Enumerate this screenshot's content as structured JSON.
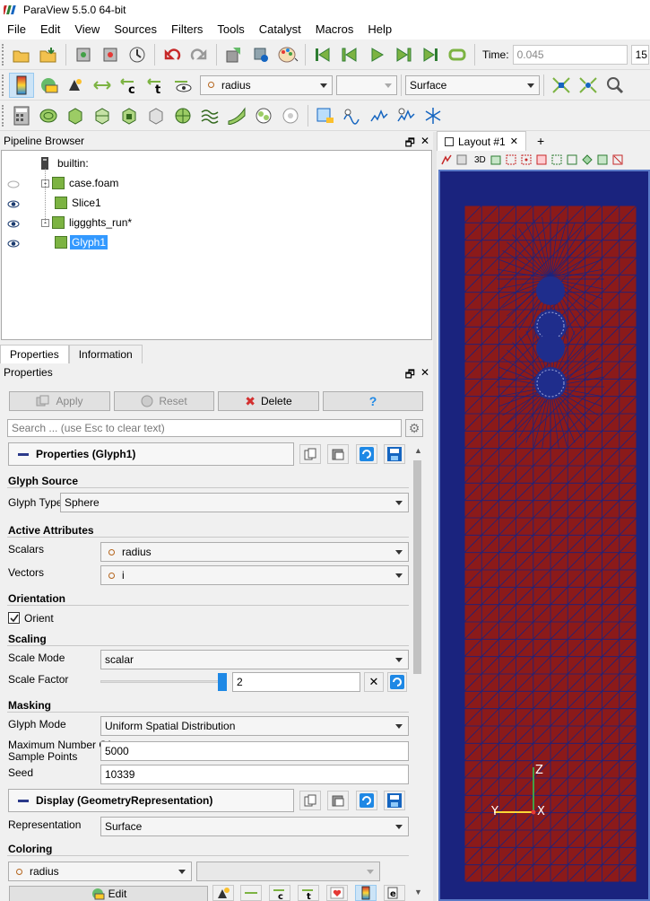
{
  "window": {
    "title": "ParaView 5.5.0 64-bit"
  },
  "menu": [
    "File",
    "Edit",
    "View",
    "Sources",
    "Filters",
    "Tools",
    "Catalyst",
    "Macros",
    "Help"
  ],
  "time": {
    "label": "Time:",
    "value": "0.045",
    "step": "15"
  },
  "toolbar2": {
    "color_array": "radius",
    "component": "",
    "representation": "Surface"
  },
  "pipeline": {
    "title": "Pipeline Browser",
    "items": [
      {
        "label": "builtin:"
      },
      {
        "label": "case.foam"
      },
      {
        "label": "Slice1"
      },
      {
        "label": "liggghts_run*"
      },
      {
        "label": "Glyph1"
      }
    ]
  },
  "tabs": {
    "properties": "Properties",
    "information": "Information"
  },
  "props_panel": {
    "title": "Properties",
    "apply": "Apply",
    "reset": "Reset",
    "delete": "Delete",
    "help": "?",
    "search_placeholder": "Search ... (use Esc to clear text)",
    "group_title": "Properties (Glyph1)",
    "glyph_source": {
      "section": "Glyph Source",
      "glyph_type_label": "Glyph Type",
      "glyph_type": "Sphere"
    },
    "active_attributes": {
      "section": "Active Attributes",
      "scalars_label": "Scalars",
      "scalars": "radius",
      "vectors_label": "Vectors",
      "vectors": "i"
    },
    "orientation": {
      "section": "Orientation",
      "orient_label": "Orient",
      "orient_checked": true
    },
    "scaling": {
      "section": "Scaling",
      "scale_mode_label": "Scale Mode",
      "scale_mode": "scalar",
      "scale_factor_label": "Scale Factor",
      "scale_factor": "2"
    },
    "masking": {
      "section": "Masking",
      "glyph_mode_label": "Glyph Mode",
      "glyph_mode": "Uniform Spatial Distribution",
      "max_points_label_1": "Maximum Number Of",
      "max_points_label_2": "Sample Points",
      "max_points": "5000",
      "seed_label": "Seed",
      "seed": "10339"
    },
    "display": {
      "group_title": "Display (GeometryRepresentation)",
      "representation_label": "Representation",
      "representation": "Surface"
    },
    "coloring": {
      "section": "Coloring",
      "array": "radius",
      "component": "",
      "edit": "Edit"
    }
  },
  "layout": {
    "tab": "Layout #1",
    "add": "+"
  },
  "view_toolbar": {
    "mode": "3D"
  },
  "axes": {
    "z": "Z",
    "y": "Y",
    "x": "X"
  },
  "colors": {
    "mesh_fill": "#8b1a1a",
    "mesh_lines": "#1a237e",
    "particles": "#1f2d8c",
    "view_border": "#5a79c7",
    "selection": "#3399ff"
  }
}
